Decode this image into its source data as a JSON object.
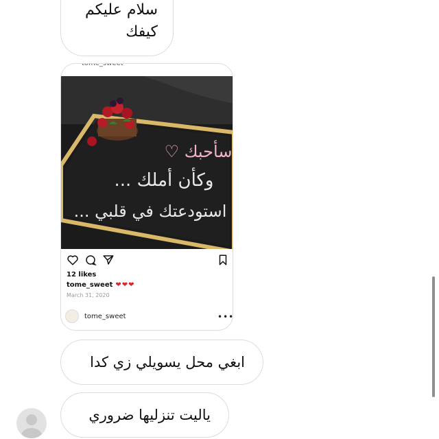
{
  "messages": {
    "first": {
      "line1": "سلام عليكم",
      "line2": "كيفك"
    },
    "second": "ابغي محل يسويلي زي كدا",
    "third": "ياليت تنزليها ضروري"
  },
  "shared_post": {
    "top_username": "tome_sweet",
    "image_text": {
      "line1": "سأحبك ♡",
      "line2": "وكأن أملك ...",
      "line3": "استودعتك في قلبي ..."
    },
    "icons": [
      "heart-icon",
      "comment-icon",
      "share-icon",
      "bookmark-icon"
    ],
    "likes": "12 likes",
    "caption_user": "tome_sweet",
    "caption_hearts": "❤❤❤",
    "date": "March 31, 2020",
    "footer_username": "tome_sweet",
    "more_icon": "•••"
  },
  "colors": {
    "bubble_border": "#dcdcdc",
    "heart_red": "#d8262b",
    "chalk_pink": "#f2b3c6"
  }
}
